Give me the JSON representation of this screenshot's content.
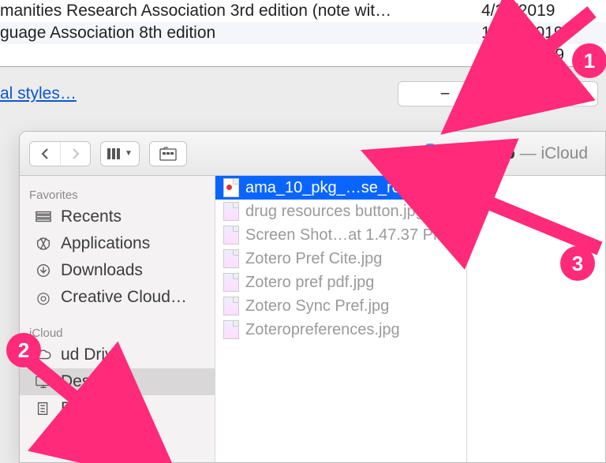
{
  "prefs": {
    "styles": [
      {
        "name": "manities Research Association 3rd edition (note wit…",
        "date": "4/27/2019"
      },
      {
        "name": "guage Association 8th edition",
        "date": "10/11/2019"
      },
      {
        "name": "",
        "date": "10/10/2019"
      }
    ],
    "link_label": "al styles…",
    "minus_label": "−",
    "plus_label": "+"
  },
  "finder": {
    "location_name": "Desktop",
    "location_suffix": " — iCloud",
    "sidebar": {
      "favorites_label": "Favorites",
      "icloud_label": "iCloud",
      "items": [
        {
          "label": "Recents",
          "icon": "recents"
        },
        {
          "label": "Applications",
          "icon": "apps"
        },
        {
          "label": "Downloads",
          "icon": "downloads"
        },
        {
          "label": "Creative Cloud…",
          "icon": "cc"
        }
      ],
      "icloud_group": [
        {
          "label": "ud Drive",
          "icon": "cloud"
        },
        {
          "label": "Desktop",
          "icon": "desktop",
          "selected": true
        },
        {
          "label": "Documents",
          "icon": "documents"
        }
      ]
    },
    "files": [
      {
        "name": "ama_10_pkg_…se_report.csl",
        "type": "csl",
        "selected": true
      },
      {
        "name": "drug resources button.jpg",
        "type": "img"
      },
      {
        "name": "Screen Shot…at 1.47.37 PM",
        "type": "img"
      },
      {
        "name": "Zotero Pref Cite.jpg",
        "type": "img"
      },
      {
        "name": "Zotero pref pdf.jpg",
        "type": "img"
      },
      {
        "name": "Zotero Sync Pref.jpg",
        "type": "img"
      },
      {
        "name": "Zoteropreferences.jpg",
        "type": "img"
      }
    ]
  },
  "annotations": {
    "badge1": "1",
    "badge2": "2",
    "badge3": "3"
  }
}
